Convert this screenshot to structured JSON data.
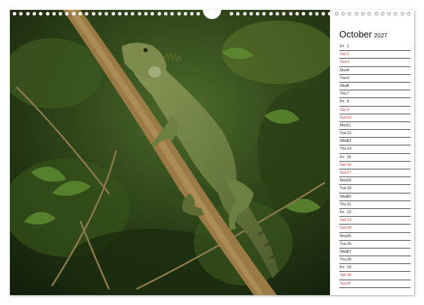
{
  "calendar": {
    "month": "October",
    "year": "2027",
    "days": [
      {
        "wd": "Fri",
        "d": "1",
        "we": false
      },
      {
        "wd": "Sat",
        "d": "2",
        "we": true
      },
      {
        "wd": "Sun",
        "d": "3",
        "we": true
      },
      {
        "wd": "Mon",
        "d": "4",
        "we": false
      },
      {
        "wd": "Tue",
        "d": "5",
        "we": false
      },
      {
        "wd": "Wed",
        "d": "6",
        "we": false
      },
      {
        "wd": "Thu",
        "d": "7",
        "we": false
      },
      {
        "wd": "Fri",
        "d": "8",
        "we": false
      },
      {
        "wd": "Sat",
        "d": "9",
        "we": true
      },
      {
        "wd": "Sun",
        "d": "10",
        "we": true
      },
      {
        "wd": "Mon",
        "d": "11",
        "we": false
      },
      {
        "wd": "Tue",
        "d": "12",
        "we": false
      },
      {
        "wd": "Wed",
        "d": "13",
        "we": false
      },
      {
        "wd": "Thu",
        "d": "14",
        "we": false
      },
      {
        "wd": "Fri",
        "d": "15",
        "we": false
      },
      {
        "wd": "Sat",
        "d": "16",
        "we": true
      },
      {
        "wd": "Sun",
        "d": "17",
        "we": true
      },
      {
        "wd": "Mon",
        "d": "18",
        "we": false
      },
      {
        "wd": "Tue",
        "d": "19",
        "we": false
      },
      {
        "wd": "Wed",
        "d": "20",
        "we": false
      },
      {
        "wd": "Thu",
        "d": "21",
        "we": false
      },
      {
        "wd": "Fri",
        "d": "22",
        "we": false
      },
      {
        "wd": "Sat",
        "d": "23",
        "we": true
      },
      {
        "wd": "Sun",
        "d": "24",
        "we": true
      },
      {
        "wd": "Mon",
        "d": "25",
        "we": false
      },
      {
        "wd": "Tue",
        "d": "26",
        "we": false
      },
      {
        "wd": "Wed",
        "d": "27",
        "we": false
      },
      {
        "wd": "Thu",
        "d": "28",
        "we": false
      },
      {
        "wd": "Fri",
        "d": "29",
        "we": false
      },
      {
        "wd": "Sat",
        "d": "30",
        "we": true
      },
      {
        "wd": "Sun",
        "d": "31",
        "we": true
      }
    ]
  },
  "colors": {
    "weekend": "#c0392b",
    "weekday": "#222222",
    "line": "#4a4a4a"
  },
  "photo": {
    "subject": "green-iguana-on-branch"
  }
}
